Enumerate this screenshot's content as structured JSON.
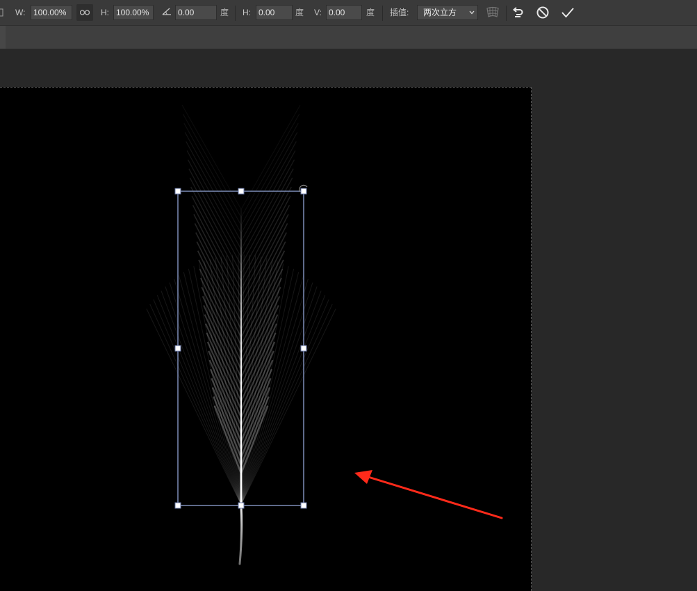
{
  "options_bar": {
    "width_label": "W:",
    "width_value": "100.00%",
    "link_icon": "link-chain-icon",
    "height_label": "H:",
    "height_value": "100.00%",
    "rotate_icon": "angle-icon",
    "rotate_value": "0.00",
    "rotate_unit": "度",
    "hskew_label": "H:",
    "hskew_value": "0.00",
    "hskew_unit": "度",
    "vskew_label": "V:",
    "vskew_value": "0.00",
    "vskew_unit": "度",
    "interpolation_label": "插值:",
    "interpolation_value": "两次立方",
    "warp_icon": "warp-mode-icon",
    "undo_icon": "undo-icon",
    "cancel_icon": "cancel-transform-icon",
    "commit_icon": "commit-checkmark-icon"
  },
  "colors": {
    "options_bar_bg": "#3a3a3a",
    "workspace_bg": "#282828",
    "canvas_bg": "#000000",
    "transform_frame": "#7d8db8",
    "annotation_arrow": "#ff2a1a"
  }
}
